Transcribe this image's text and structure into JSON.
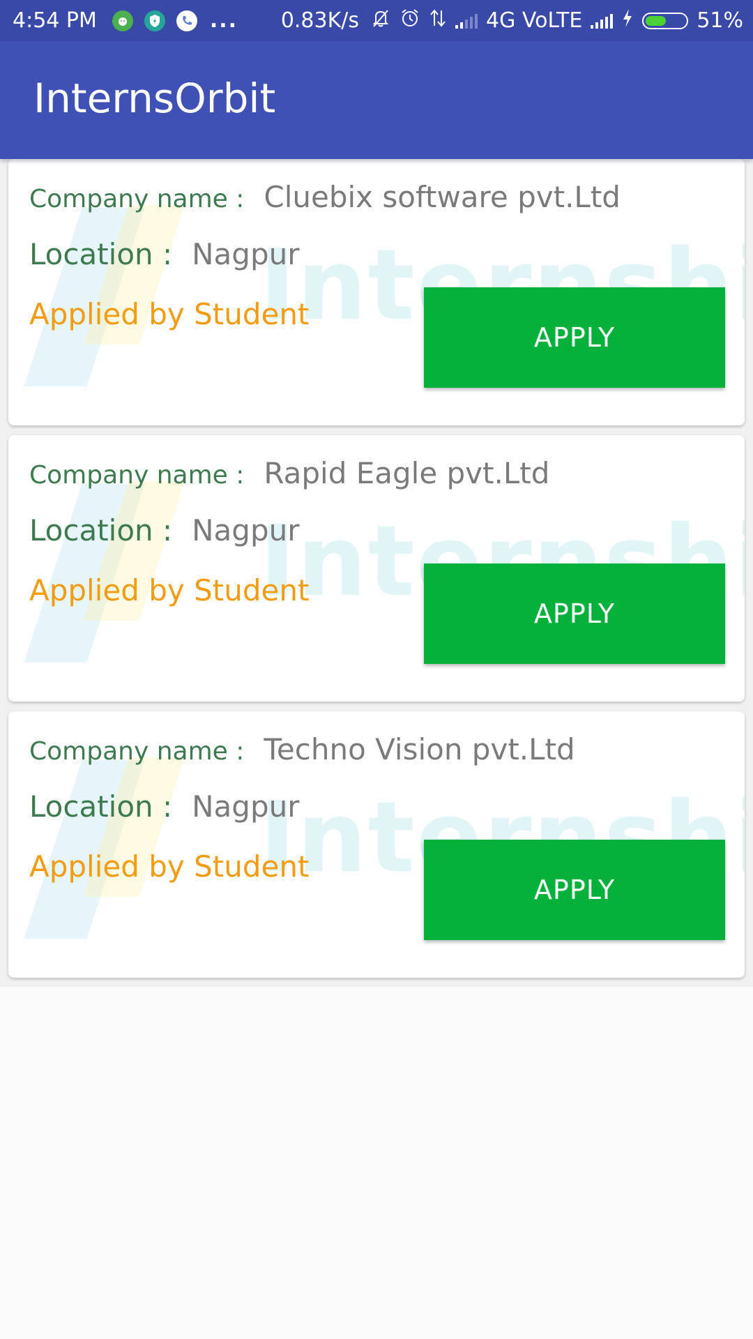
{
  "status_bar": {
    "time": "4:54 PM",
    "more": "...",
    "net_speed": "0.83K/s",
    "network_label": "4G VoLTE",
    "battery_percent": "51%",
    "battery_level": 0.51,
    "icons": [
      "android-notification-icon",
      "shield-notification-icon",
      "phone-notification-icon",
      "bell-off-icon",
      "alarm-icon",
      "data-arrows-icon",
      "signal-icon",
      "charging-icon",
      "battery-icon"
    ]
  },
  "app_bar": {
    "title": "InternsOrbit",
    "color": "#3f51b5"
  },
  "cards": [
    {
      "company_label": "Company name :",
      "company_name": "Cluebix software pvt.Ltd",
      "location_label": "Location :",
      "location": "Nagpur",
      "status": "Applied by Student",
      "button_label": "APPLY"
    },
    {
      "company_label": "Company name :",
      "company_name": "Rapid Eagle pvt.Ltd",
      "location_label": "Location :",
      "location": "Nagpur",
      "status": "Applied by Student",
      "button_label": "APPLY"
    },
    {
      "company_label": "Company name :",
      "company_name": "Techno Vision pvt.Ltd",
      "location_label": "Location :",
      "location": "Nagpur",
      "status": "Applied by Student",
      "button_label": "APPLY"
    }
  ],
  "watermark": {
    "text": "Internships"
  },
  "colors": {
    "label_green": "#3d7a4f",
    "status_orange": "#f39c12",
    "button_green": "#05b03b",
    "status_bar": "#3949a8"
  }
}
